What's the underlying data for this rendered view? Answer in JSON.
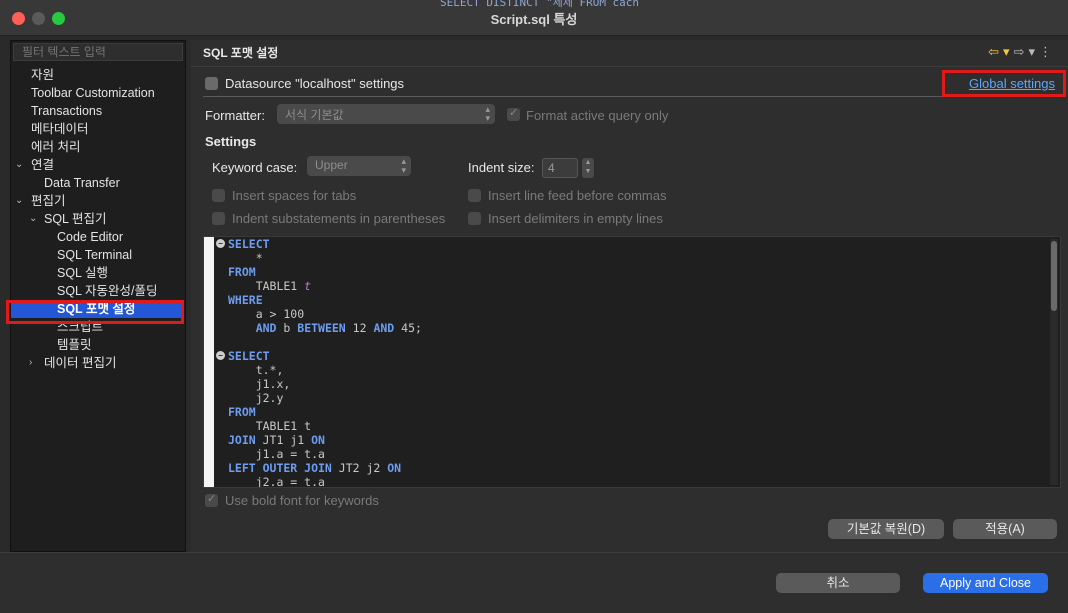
{
  "window": {
    "title": "Script.sql 특성",
    "bg_text": "SELECT DISTINCT \"세제 FROM cach"
  },
  "left": {
    "filter_placeholder": "필터 텍스트 입력",
    "tree": [
      {
        "label": "자원",
        "depth": 0,
        "arrow": ""
      },
      {
        "label": "Toolbar Customization",
        "depth": 0,
        "arrow": ""
      },
      {
        "label": "Transactions",
        "depth": 0,
        "arrow": ""
      },
      {
        "label": "메타데이터",
        "depth": 0,
        "arrow": ""
      },
      {
        "label": "에러 처리",
        "depth": 0,
        "arrow": ""
      },
      {
        "label": "연결",
        "depth": 0,
        "arrow": "v"
      },
      {
        "label": "Data Transfer",
        "depth": 1,
        "arrow": ""
      },
      {
        "label": "편집기",
        "depth": 0,
        "arrow": "v"
      },
      {
        "label": "SQL 편집기",
        "depth": 1,
        "arrow": "v"
      },
      {
        "label": "Code Editor",
        "depth": 2,
        "arrow": ""
      },
      {
        "label": "SQL Terminal",
        "depth": 2,
        "arrow": ""
      },
      {
        "label": "SQL 실행",
        "depth": 2,
        "arrow": ""
      },
      {
        "label": "SQL 자동완성/폴딩",
        "depth": 2,
        "arrow": ""
      },
      {
        "label": "SQL 포맷 설정",
        "depth": 2,
        "arrow": "",
        "selected": true
      },
      {
        "label": "스크립트",
        "depth": 2,
        "arrow": ""
      },
      {
        "label": "템플릿",
        "depth": 2,
        "arrow": ""
      },
      {
        "label": "데이터 편집기",
        "depth": 1,
        "arrow": ">"
      }
    ]
  },
  "right": {
    "header_title": "SQL 포맷 설정",
    "datasource_label": "Datasource \"localhost\" settings",
    "global_settings_link": "Global settings",
    "formatter_label": "Formatter:",
    "formatter_value": "서식 기본값",
    "format_active_label": "Format active query only",
    "settings_title": "Settings",
    "keyword_case_label": "Keyword case:",
    "keyword_case_value": "Upper",
    "indent_size_label": "Indent size:",
    "indent_size_value": "4",
    "insert_spaces_label": "Insert spaces for tabs",
    "insert_line_feed_label": "Insert line feed before commas",
    "indent_sub_label": "Indent substatements in parentheses",
    "insert_delim_label": "Insert delimiters in empty lines",
    "bold_keywords_label": "Use bold font for keywords",
    "restore_defaults": "기본값 복원(D)",
    "apply": "적용(A)"
  },
  "code_preview": [
    [
      {
        "t": "kw",
        "v": "SELECT"
      }
    ],
    [
      {
        "t": "id",
        "v": "    *"
      }
    ],
    [
      {
        "t": "kw",
        "v": "FROM"
      }
    ],
    [
      {
        "t": "id",
        "v": "    TABLE1 "
      },
      {
        "t": "al",
        "v": "t"
      }
    ],
    [
      {
        "t": "kw",
        "v": "WHERE"
      }
    ],
    [
      {
        "t": "id",
        "v": "    a > 100"
      }
    ],
    [
      {
        "t": "id",
        "v": "    "
      },
      {
        "t": "kw",
        "v": "AND"
      },
      {
        "t": "id",
        "v": " b "
      },
      {
        "t": "kw",
        "v": "BETWEEN"
      },
      {
        "t": "id",
        "v": " 12 "
      },
      {
        "t": "kw",
        "v": "AND"
      },
      {
        "t": "id",
        "v": " 45;"
      }
    ],
    [
      {
        "t": "id",
        "v": ""
      }
    ],
    [
      {
        "t": "kw",
        "v": "SELECT"
      }
    ],
    [
      {
        "t": "id",
        "v": "    t.*,"
      }
    ],
    [
      {
        "t": "id",
        "v": "    j1.x,"
      }
    ],
    [
      {
        "t": "id",
        "v": "    j2.y"
      }
    ],
    [
      {
        "t": "kw",
        "v": "FROM"
      }
    ],
    [
      {
        "t": "id",
        "v": "    TABLE1 t"
      }
    ],
    [
      {
        "t": "kw",
        "v": "JOIN"
      },
      {
        "t": "id",
        "v": " JT1 j1 "
      },
      {
        "t": "kw",
        "v": "ON"
      }
    ],
    [
      {
        "t": "id",
        "v": "    j1.a = t.a"
      }
    ],
    [
      {
        "t": "kw",
        "v": "LEFT OUTER JOIN"
      },
      {
        "t": "id",
        "v": " JT2 j2 "
      },
      {
        "t": "kw",
        "v": "ON"
      }
    ],
    [
      {
        "t": "id",
        "v": "    j2.a = t.a"
      }
    ]
  ],
  "footer": {
    "cancel": "취소",
    "apply_close": "Apply and Close"
  }
}
